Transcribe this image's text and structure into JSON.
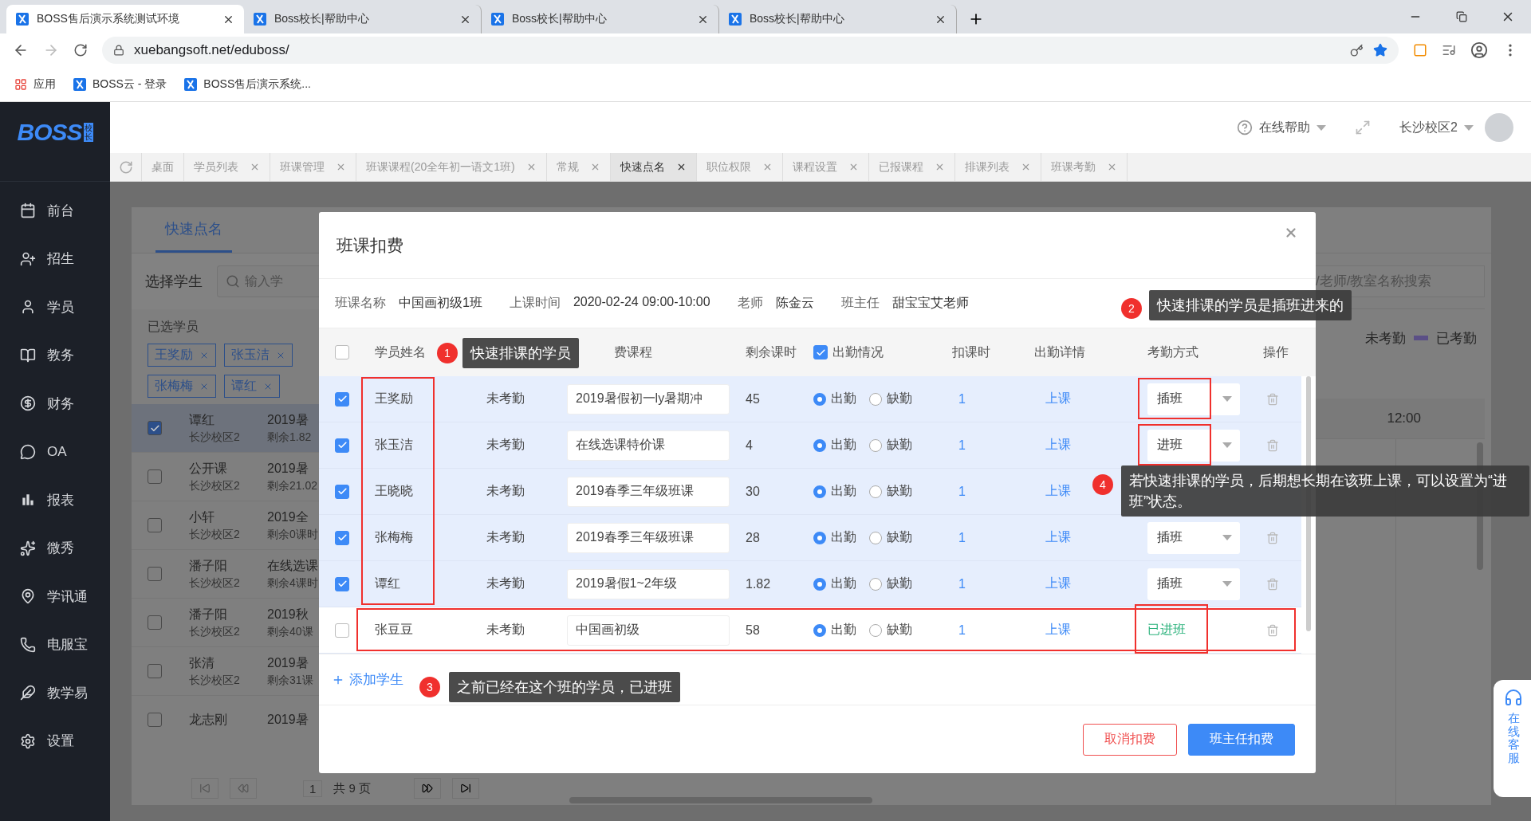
{
  "browser": {
    "tabs": [
      {
        "title": "BOSS售后演示系统测试环境",
        "selected": true
      },
      {
        "title": "Boss校长|帮助中心",
        "selected": false
      },
      {
        "title": "Boss校长|帮助中心",
        "selected": false
      },
      {
        "title": "Boss校长|帮助中心",
        "selected": false
      }
    ],
    "url": "xuebangsoft.net/eduboss/",
    "bookmarks": [
      "应用",
      "BOSS云 - 登录",
      "BOSS售后演示系统..."
    ]
  },
  "header": {
    "logo": "BOSS",
    "logo_badge": "校长",
    "help": "在线帮助",
    "campus": "长沙校区2"
  },
  "page_tabs": [
    {
      "label": "桌面",
      "closable": false,
      "selected": false
    },
    {
      "label": "学员列表",
      "closable": true,
      "selected": false
    },
    {
      "label": "班课管理",
      "closable": true,
      "selected": false
    },
    {
      "label": "班课课程(20全年初一语文1班)",
      "closable": true,
      "selected": false
    },
    {
      "label": "常规",
      "closable": true,
      "selected": false
    },
    {
      "label": "快速点名",
      "closable": true,
      "selected": true
    },
    {
      "label": "职位权限",
      "closable": true,
      "selected": false
    },
    {
      "label": "课程设置",
      "closable": true,
      "selected": false
    },
    {
      "label": "已报课程",
      "closable": true,
      "selected": false
    },
    {
      "label": "排课列表",
      "closable": true,
      "selected": false
    },
    {
      "label": "班课考勤",
      "closable": true,
      "selected": false
    }
  ],
  "sidebar": [
    {
      "label": "前台"
    },
    {
      "label": "招生"
    },
    {
      "label": "学员"
    },
    {
      "label": "教务"
    },
    {
      "label": "财务"
    },
    {
      "label": "OA"
    },
    {
      "label": "报表"
    },
    {
      "label": "微秀"
    },
    {
      "label": "学讯通"
    },
    {
      "label": "电服宝"
    },
    {
      "label": "教学易"
    },
    {
      "label": "设置"
    }
  ],
  "background": {
    "tab": "快速点名",
    "select_label": "选择学生",
    "search_placeholder": "输入学",
    "selected_label": "已选学员",
    "tags": [
      "王奖励",
      "张玉洁",
      "张梅梅",
      "谭红"
    ],
    "students": [
      {
        "name": "谭红",
        "campus": "长沙校区2",
        "course": "2019暑",
        "remaining": "剩余1.82",
        "checked": true,
        "selected": true
      },
      {
        "name": "公开课",
        "campus": "长沙校区2",
        "course": "2019暑",
        "remaining": "剩余21.02",
        "checked": false,
        "selected": false
      },
      {
        "name": "小轩",
        "campus": "长沙校区2",
        "course": "2019全",
        "remaining": "剩余0课时",
        "checked": false,
        "selected": false
      },
      {
        "name": "潘子阳",
        "campus": "长沙校区2",
        "course": "在线选课",
        "remaining": "剩余4课时",
        "checked": false,
        "selected": false
      },
      {
        "name": "潘子阳",
        "campus": "长沙校区2",
        "course": "2019秋",
        "remaining": "剩余40课",
        "checked": false,
        "selected": false
      },
      {
        "name": "张清",
        "campus": "长沙校区2",
        "course": "2019暑",
        "remaining": "剩余31课",
        "checked": false,
        "selected": false
      },
      {
        "name": "龙志刚",
        "course": "2019暑",
        "checked": false,
        "selected": false
      }
    ],
    "page_current": "1",
    "page_total": "共 9 页",
    "right_search_placeholder": "/老师/教室名称搜索",
    "legend": [
      {
        "label": "未考勤"
      },
      {
        "label": "已考勤",
        "color": "#5b4f86"
      }
    ],
    "time": "12:00"
  },
  "dialog": {
    "title": "班课扣费",
    "info": [
      {
        "label": "班课名称",
        "value": "中国画初级1班"
      },
      {
        "label": "上课时间",
        "value": "2020-02-24 09:00-10:00"
      },
      {
        "label": "老师",
        "value": "陈金云"
      },
      {
        "label": "班主任",
        "value": "甜宝宝艾老师"
      }
    ],
    "headers": {
      "select_all_checked": false,
      "name": "学员姓名",
      "course": "费课程",
      "remaining": "剩余课时",
      "attendance_checked": true,
      "attendance": "出勤情况",
      "deduct": "扣课时",
      "detail": "出勤详情",
      "mode": "考勤方式",
      "action": "操作"
    },
    "rows": [
      {
        "checked": true,
        "name": "王奖励",
        "status": "未考勤",
        "course": "2019暑假初一ly暑期冲",
        "remaining": "45",
        "present": true,
        "present_label": "出勤",
        "absent_label": "缺勤",
        "deduct": "1",
        "detail": "上课",
        "kind": "select",
        "mode": "插班"
      },
      {
        "checked": true,
        "name": "张玉洁",
        "status": "未考勤",
        "course": "在线选课特价课",
        "remaining": "4",
        "present": true,
        "present_label": "出勤",
        "absent_label": "缺勤",
        "deduct": "1",
        "detail": "上课",
        "kind": "select",
        "mode": "进班"
      },
      {
        "checked": true,
        "name": "王晓晓",
        "status": "未考勤",
        "course": "2019春季三年级班课",
        "remaining": "30",
        "present": true,
        "present_label": "出勤",
        "absent_label": "缺勤",
        "deduct": "1",
        "detail": "上课",
        "kind": "covered"
      },
      {
        "checked": true,
        "name": "张梅梅",
        "status": "未考勤",
        "course": "2019春季三年级班课",
        "remaining": "28",
        "present": true,
        "present_label": "出勤",
        "absent_label": "缺勤",
        "deduct": "1",
        "detail": "上课",
        "kind": "select",
        "mode": "插班"
      },
      {
        "checked": true,
        "name": "谭红",
        "status": "未考勤",
        "course": "2019暑假1~2年级",
        "remaining": "1.82",
        "present": true,
        "present_label": "出勤",
        "absent_label": "缺勤",
        "deduct": "1",
        "detail": "上课",
        "kind": "select",
        "mode": "插班"
      },
      {
        "checked": false,
        "name": "张豆豆",
        "status": "未考勤",
        "course": "中国画初级",
        "remaining": "58",
        "present": true,
        "present_label": "出勤",
        "absent_label": "缺勤",
        "deduct": "1",
        "detail": "上课",
        "kind": "enrolled",
        "mode": "已进班"
      }
    ],
    "add_student": "添加学生",
    "buttons": [
      {
        "label": "取消扣费",
        "kind": "secondary"
      },
      {
        "label": "班主任扣费",
        "kind": "primary"
      }
    ]
  },
  "annotations": [
    {
      "number": "1",
      "text": "快速排课的学员"
    },
    {
      "number": "2",
      "text": "快速排课的学员是插班进来的"
    },
    {
      "number": "3",
      "text": "之前已经在这个班的学员，已进班"
    },
    {
      "number": "4",
      "text": "若快速排课的学员，后期想长期在该班上课，可以设置为“进班”状态。"
    }
  ],
  "service_widget": "在线客服"
}
